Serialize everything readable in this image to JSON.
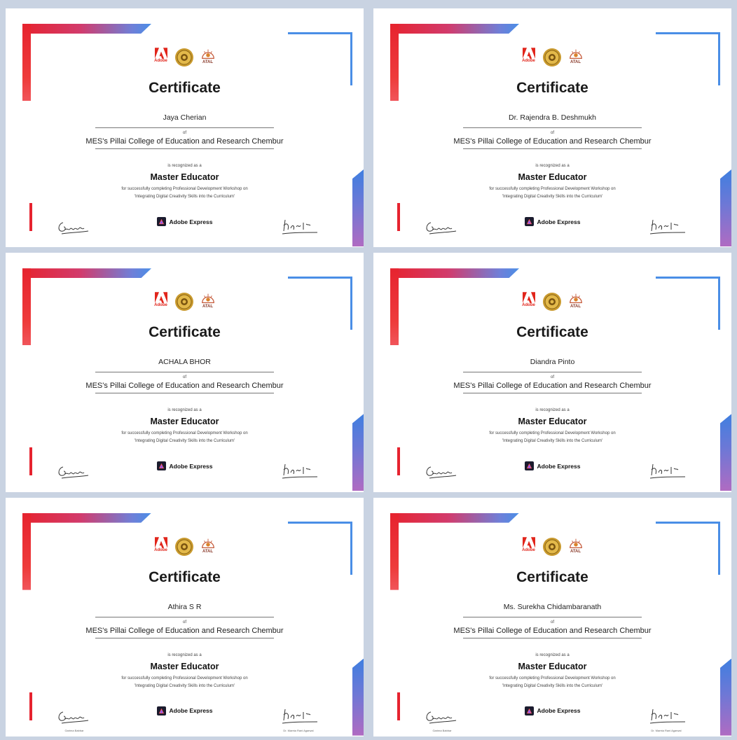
{
  "common": {
    "title": "Certificate",
    "of": "of",
    "college": "MES's Pillai College of Education and Research Chembur",
    "recognized": "is recognized as a",
    "role": "Master Educator",
    "desc_line1": "for successfully completing Professional Development Workshop on",
    "desc_line2": "'Integrating Digital Creativity Skills into the Curriculum'",
    "product": "Adobe Express",
    "adobe_wordmark": "Adobe",
    "atal_wordmark": "ATAL"
  },
  "certificates": [
    {
      "name": "Jaya Cherian",
      "signer_left": "",
      "signer_right": ""
    },
    {
      "name": "Dr. Rajendra B. Deshmukh",
      "signer_left": "",
      "signer_right": ""
    },
    {
      "name": "ACHALA BHOR",
      "signer_left": "",
      "signer_right": ""
    },
    {
      "name": "Diandra Pinto",
      "signer_left": "",
      "signer_right": ""
    },
    {
      "name": "Athira S R",
      "signer_left": "Garima Babbar",
      "signer_right": "Dr. Mamta Rani Agarwal"
    },
    {
      "name": "Ms. Surekha Chidambaranath",
      "signer_left": "Garima Babbar",
      "signer_right": "Dr. Mamta Rani Agarwal"
    }
  ],
  "colors": {
    "adobe_red": "#e6232f",
    "accent_blue": "#4a8ee6",
    "gradient_purple": "#b06bc2",
    "background": "#c9d3e2"
  },
  "icons": [
    "adobe-logo-icon",
    "college-seal-icon",
    "atal-logo-icon",
    "adobe-express-icon",
    "signature-icon"
  ]
}
